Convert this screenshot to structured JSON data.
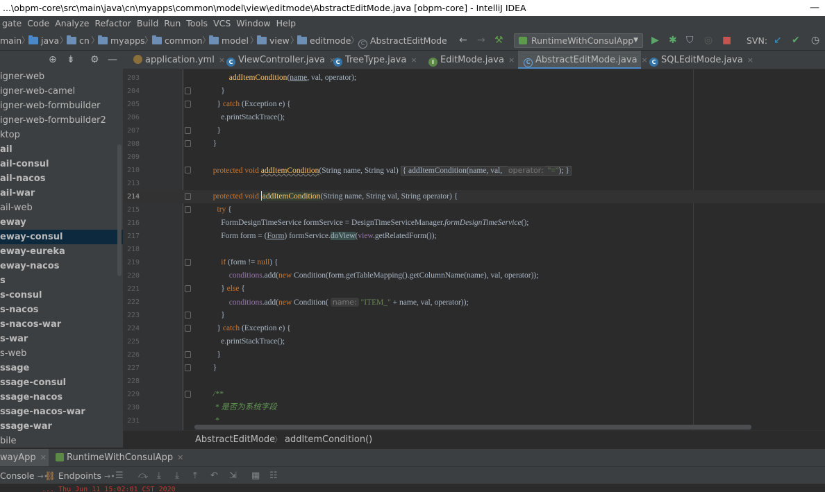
{
  "window": {
    "title": "...\\obpm-core\\src\\main\\java\\cn\\myapps\\common\\model\\view\\editmode\\AbstractEditMode.java [obpm-core] - IntelliJ IDEA",
    "minimize_glyph": "—"
  },
  "menu": [
    "gate",
    "Code",
    "Analyze",
    "Refactor",
    "Build",
    "Run",
    "Tools",
    "VCS",
    "Window",
    "Help"
  ],
  "breadcrumb": [
    "main",
    "java",
    "cn",
    "myapps",
    "common",
    "model",
    "view",
    "editmode",
    "AbstractEditMode"
  ],
  "run_config": {
    "name": "RuntimeWithConsulApp"
  },
  "vcs": {
    "label": "SVN:"
  },
  "sidebar": {
    "items": [
      {
        "label": "igner-web",
        "bold": false
      },
      {
        "label": "igner-web-camel",
        "bold": false
      },
      {
        "label": "igner-web-formbuilder",
        "bold": false
      },
      {
        "label": "igner-web-formbuilder2",
        "bold": false
      },
      {
        "label": "ktop",
        "bold": false
      },
      {
        "label": "ail",
        "bold": true
      },
      {
        "label": "ail-consul",
        "bold": true
      },
      {
        "label": "ail-nacos",
        "bold": true
      },
      {
        "label": "ail-war",
        "bold": true
      },
      {
        "label": "ail-web",
        "bold": false
      },
      {
        "label": "eway",
        "bold": true
      },
      {
        "label": "eway-consul",
        "bold": true
      },
      {
        "label": "eway-eureka",
        "bold": true
      },
      {
        "label": "eway-nacos",
        "bold": true
      },
      {
        "label": "s",
        "bold": true
      },
      {
        "label": "s-consul",
        "bold": true
      },
      {
        "label": "s-nacos",
        "bold": true
      },
      {
        "label": "s-nacos-war",
        "bold": true
      },
      {
        "label": "s-war",
        "bold": true
      },
      {
        "label": "s-web",
        "bold": false
      },
      {
        "label": "ssage",
        "bold": true
      },
      {
        "label": "ssage-consul",
        "bold": true
      },
      {
        "label": "ssage-nacos",
        "bold": true
      },
      {
        "label": "ssage-nacos-war",
        "bold": true
      },
      {
        "label": "ssage-war",
        "bold": true
      },
      {
        "label": "bile",
        "bold": false
      }
    ],
    "selected_index": 11
  },
  "tabs": [
    {
      "label": "application.yml",
      "icon": "yaml-file-icon",
      "glyph": "",
      "active": false
    },
    {
      "label": "ViewController.java",
      "icon": "class-file-icon",
      "glyph": "C",
      "active": false
    },
    {
      "label": "TreeType.java",
      "icon": "class-file-icon",
      "glyph": "C",
      "active": false
    },
    {
      "label": "EditMode.java",
      "icon": "interface-file-icon",
      "glyph": "I",
      "active": false
    },
    {
      "label": "AbstractEditMode.java",
      "icon": "abstract-class-file-icon",
      "glyph": "C",
      "active": true
    },
    {
      "label": "SQLEditMode.java",
      "icon": "class-file-icon",
      "glyph": "C",
      "active": false
    }
  ],
  "tab_close_glyph": "×",
  "code": {
    "line_numbers": [
      "203",
      "204",
      "205",
      "206",
      "207",
      "208",
      "209",
      "210",
      "213",
      "214",
      "215",
      "216",
      "217",
      "218",
      "219",
      "220",
      "221",
      "222",
      "223",
      "224",
      "225",
      "226",
      "227",
      "228",
      "229",
      "230",
      "231"
    ],
    "current_line": "214",
    "hint_name": "name:",
    "hint_operator": "operator:",
    "comment_text": " * 是否为系统字段"
  },
  "editor_breadcrumb": [
    "AbstractEditMode",
    "addItemCondition()"
  ],
  "run_tabs": [
    {
      "label": "wayApp",
      "active": true
    },
    {
      "label": "RuntimeWithConsulApp",
      "active": false
    }
  ],
  "run_toolbar": {
    "console": "Console",
    "endpoints": "Endpoints"
  },
  "console_line": "  ...  Thu Jun 11 15:02:01 CST 2020"
}
